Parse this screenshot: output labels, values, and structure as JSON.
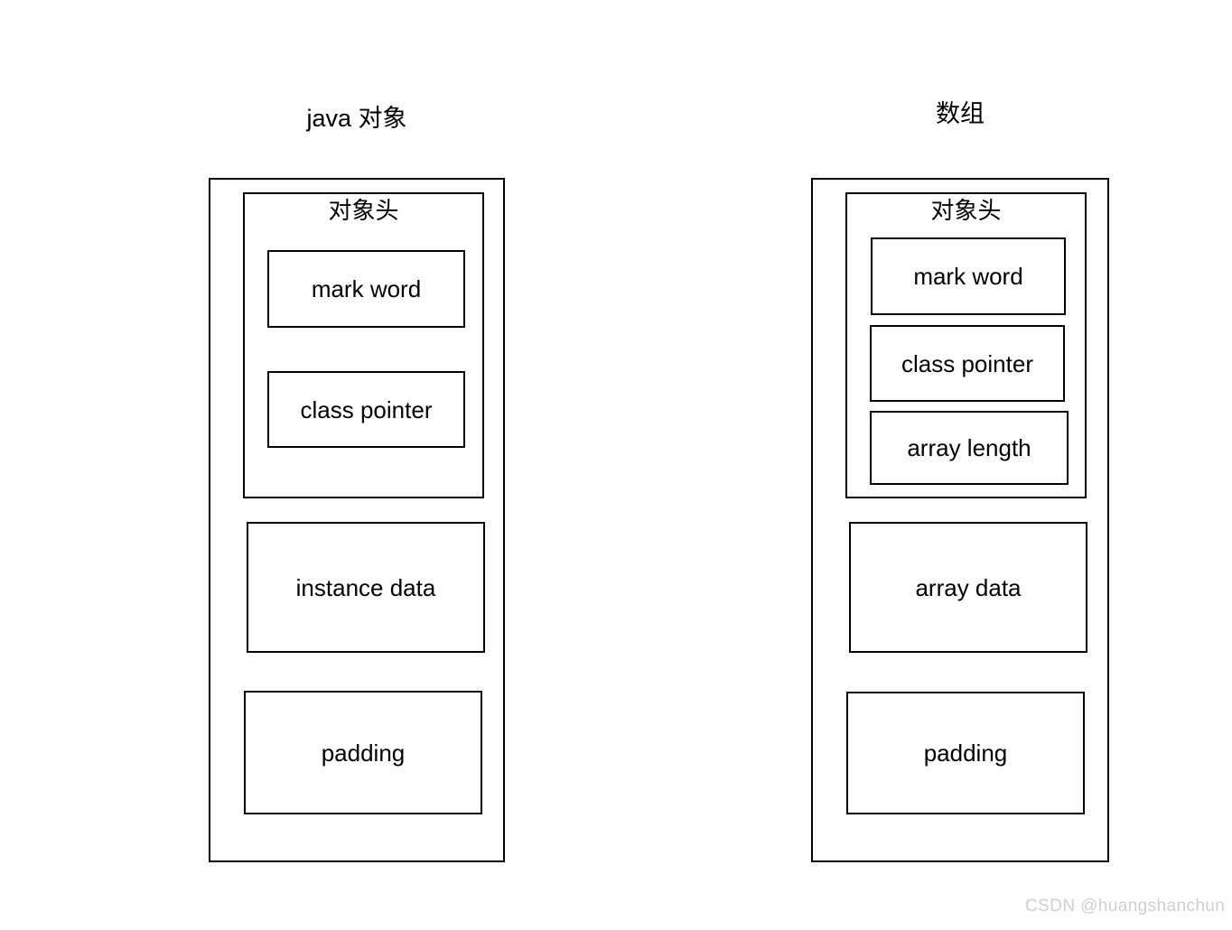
{
  "diagrams": [
    {
      "id": "java-object",
      "title": "java 对象",
      "header": {
        "label": "对象头",
        "fields": [
          {
            "label": "mark word"
          },
          {
            "label": "class pointer"
          }
        ]
      },
      "sections": [
        {
          "label": "instance data"
        },
        {
          "label": "padding"
        }
      ]
    },
    {
      "id": "array",
      "title": "数组",
      "header": {
        "label": "对象头",
        "fields": [
          {
            "label": "mark word"
          },
          {
            "label": "class pointer"
          },
          {
            "label": "array length"
          }
        ]
      },
      "sections": [
        {
          "label": "array data"
        },
        {
          "label": "padding"
        }
      ]
    }
  ],
  "watermark": {
    "text": "CSDN @huangshanchun"
  },
  "colors": {
    "background": "#ffffff",
    "stroke": "#000000",
    "text": "#000000",
    "watermark": "#cfcfcf"
  }
}
